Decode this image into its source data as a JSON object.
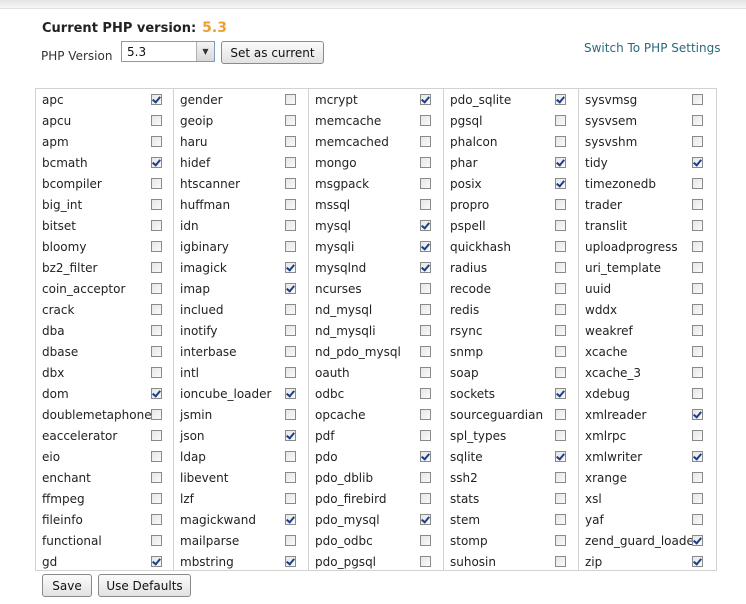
{
  "header": {
    "current_label": "Current PHP version:",
    "current_value": "5.3",
    "version_label": "PHP Version",
    "select_value": "5.3",
    "set_button": "Set as current",
    "switch_link": "Switch To PHP Settings"
  },
  "footer": {
    "save_button": "Save",
    "defaults_button": "Use Defaults"
  },
  "columns": [
    [
      {
        "name": "apc",
        "checked": true
      },
      {
        "name": "apcu",
        "checked": false
      },
      {
        "name": "apm",
        "checked": false
      },
      {
        "name": "bcmath",
        "checked": true
      },
      {
        "name": "bcompiler",
        "checked": false
      },
      {
        "name": "big_int",
        "checked": false
      },
      {
        "name": "bitset",
        "checked": false
      },
      {
        "name": "bloomy",
        "checked": false
      },
      {
        "name": "bz2_filter",
        "checked": false
      },
      {
        "name": "coin_acceptor",
        "checked": false
      },
      {
        "name": "crack",
        "checked": false
      },
      {
        "name": "dba",
        "checked": false
      },
      {
        "name": "dbase",
        "checked": false
      },
      {
        "name": "dbx",
        "checked": false
      },
      {
        "name": "dom",
        "checked": true
      },
      {
        "name": "doublemetaphone",
        "checked": false
      },
      {
        "name": "eaccelerator",
        "checked": false
      },
      {
        "name": "eio",
        "checked": false
      },
      {
        "name": "enchant",
        "checked": false
      },
      {
        "name": "ffmpeg",
        "checked": false
      },
      {
        "name": "fileinfo",
        "checked": false
      },
      {
        "name": "functional",
        "checked": false
      },
      {
        "name": "gd",
        "checked": true
      }
    ],
    [
      {
        "name": "gender",
        "checked": false
      },
      {
        "name": "geoip",
        "checked": false
      },
      {
        "name": "haru",
        "checked": false
      },
      {
        "name": "hidef",
        "checked": false
      },
      {
        "name": "htscanner",
        "checked": false
      },
      {
        "name": "huffman",
        "checked": false
      },
      {
        "name": "idn",
        "checked": false
      },
      {
        "name": "igbinary",
        "checked": false
      },
      {
        "name": "imagick",
        "checked": true
      },
      {
        "name": "imap",
        "checked": true
      },
      {
        "name": "inclued",
        "checked": false
      },
      {
        "name": "inotify",
        "checked": false
      },
      {
        "name": "interbase",
        "checked": false
      },
      {
        "name": "intl",
        "checked": false
      },
      {
        "name": "ioncube_loader",
        "checked": true
      },
      {
        "name": "jsmin",
        "checked": false
      },
      {
        "name": "json",
        "checked": true
      },
      {
        "name": "ldap",
        "checked": false
      },
      {
        "name": "libevent",
        "checked": false
      },
      {
        "name": "lzf",
        "checked": false
      },
      {
        "name": "magickwand",
        "checked": true
      },
      {
        "name": "mailparse",
        "checked": false
      },
      {
        "name": "mbstring",
        "checked": true
      }
    ],
    [
      {
        "name": "mcrypt",
        "checked": true
      },
      {
        "name": "memcache",
        "checked": false
      },
      {
        "name": "memcached",
        "checked": false
      },
      {
        "name": "mongo",
        "checked": false
      },
      {
        "name": "msgpack",
        "checked": false
      },
      {
        "name": "mssql",
        "checked": false
      },
      {
        "name": "mysql",
        "checked": true
      },
      {
        "name": "mysqli",
        "checked": true
      },
      {
        "name": "mysqlnd",
        "checked": true
      },
      {
        "name": "ncurses",
        "checked": false
      },
      {
        "name": "nd_mysql",
        "checked": false
      },
      {
        "name": "nd_mysqli",
        "checked": false
      },
      {
        "name": "nd_pdo_mysql",
        "checked": false
      },
      {
        "name": "oauth",
        "checked": false
      },
      {
        "name": "odbc",
        "checked": false
      },
      {
        "name": "opcache",
        "checked": false
      },
      {
        "name": "pdf",
        "checked": false
      },
      {
        "name": "pdo",
        "checked": true
      },
      {
        "name": "pdo_dblib",
        "checked": false
      },
      {
        "name": "pdo_firebird",
        "checked": false
      },
      {
        "name": "pdo_mysql",
        "checked": true
      },
      {
        "name": "pdo_odbc",
        "checked": false
      },
      {
        "name": "pdo_pgsql",
        "checked": false
      }
    ],
    [
      {
        "name": "pdo_sqlite",
        "checked": true
      },
      {
        "name": "pgsql",
        "checked": false
      },
      {
        "name": "phalcon",
        "checked": false
      },
      {
        "name": "phar",
        "checked": true
      },
      {
        "name": "posix",
        "checked": true
      },
      {
        "name": "propro",
        "checked": false
      },
      {
        "name": "pspell",
        "checked": false
      },
      {
        "name": "quickhash",
        "checked": false
      },
      {
        "name": "radius",
        "checked": false
      },
      {
        "name": "recode",
        "checked": false
      },
      {
        "name": "redis",
        "checked": false
      },
      {
        "name": "rsync",
        "checked": false
      },
      {
        "name": "snmp",
        "checked": false
      },
      {
        "name": "soap",
        "checked": false
      },
      {
        "name": "sockets",
        "checked": true
      },
      {
        "name": "sourceguardian",
        "checked": false
      },
      {
        "name": "spl_types",
        "checked": false
      },
      {
        "name": "sqlite",
        "checked": true
      },
      {
        "name": "ssh2",
        "checked": false
      },
      {
        "name": "stats",
        "checked": false
      },
      {
        "name": "stem",
        "checked": false
      },
      {
        "name": "stomp",
        "checked": false
      },
      {
        "name": "suhosin",
        "checked": false
      }
    ],
    [
      {
        "name": "sysvmsg",
        "checked": false
      },
      {
        "name": "sysvsem",
        "checked": false
      },
      {
        "name": "sysvshm",
        "checked": false
      },
      {
        "name": "tidy",
        "checked": true
      },
      {
        "name": "timezonedb",
        "checked": false
      },
      {
        "name": "trader",
        "checked": false
      },
      {
        "name": "translit",
        "checked": false
      },
      {
        "name": "uploadprogress",
        "checked": false
      },
      {
        "name": "uri_template",
        "checked": false
      },
      {
        "name": "uuid",
        "checked": false
      },
      {
        "name": "wddx",
        "checked": false
      },
      {
        "name": "weakref",
        "checked": false
      },
      {
        "name": "xcache",
        "checked": false
      },
      {
        "name": "xcache_3",
        "checked": false
      },
      {
        "name": "xdebug",
        "checked": false
      },
      {
        "name": "xmlreader",
        "checked": true
      },
      {
        "name": "xmlrpc",
        "checked": false
      },
      {
        "name": "xmlwriter",
        "checked": true
      },
      {
        "name": "xrange",
        "checked": false
      },
      {
        "name": "xsl",
        "checked": false
      },
      {
        "name": "yaf",
        "checked": false
      },
      {
        "name": "zend_guard_loader",
        "checked": true
      },
      {
        "name": "zip",
        "checked": true
      }
    ]
  ]
}
